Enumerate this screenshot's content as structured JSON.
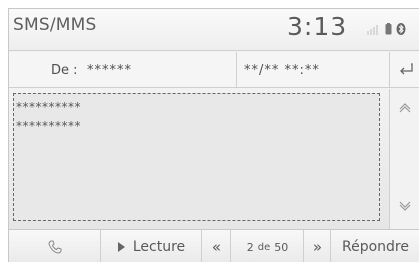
{
  "header": {
    "title": "SMS/MMS",
    "clock": "3:13",
    "status_icons": [
      "signal-icon",
      "phone-battery-icon",
      "bluetooth-icon"
    ]
  },
  "message_info": {
    "from_label": "De :",
    "from_value": "******",
    "date_value": "**/** **:**",
    "back_icon": "back-arrow-icon"
  },
  "message": {
    "lines": [
      "**********",
      "**********"
    ]
  },
  "scroll": {
    "up_icon": "chevron-up-icon",
    "down_icon": "chevron-down-icon"
  },
  "toolbar": {
    "call_icon": "phone-handset-icon",
    "play_label": "Lecture",
    "prev_label": "«",
    "page_current": "2",
    "page_sep": "de",
    "page_total": "50",
    "next_label": "»",
    "reply_label": "Répondre"
  }
}
